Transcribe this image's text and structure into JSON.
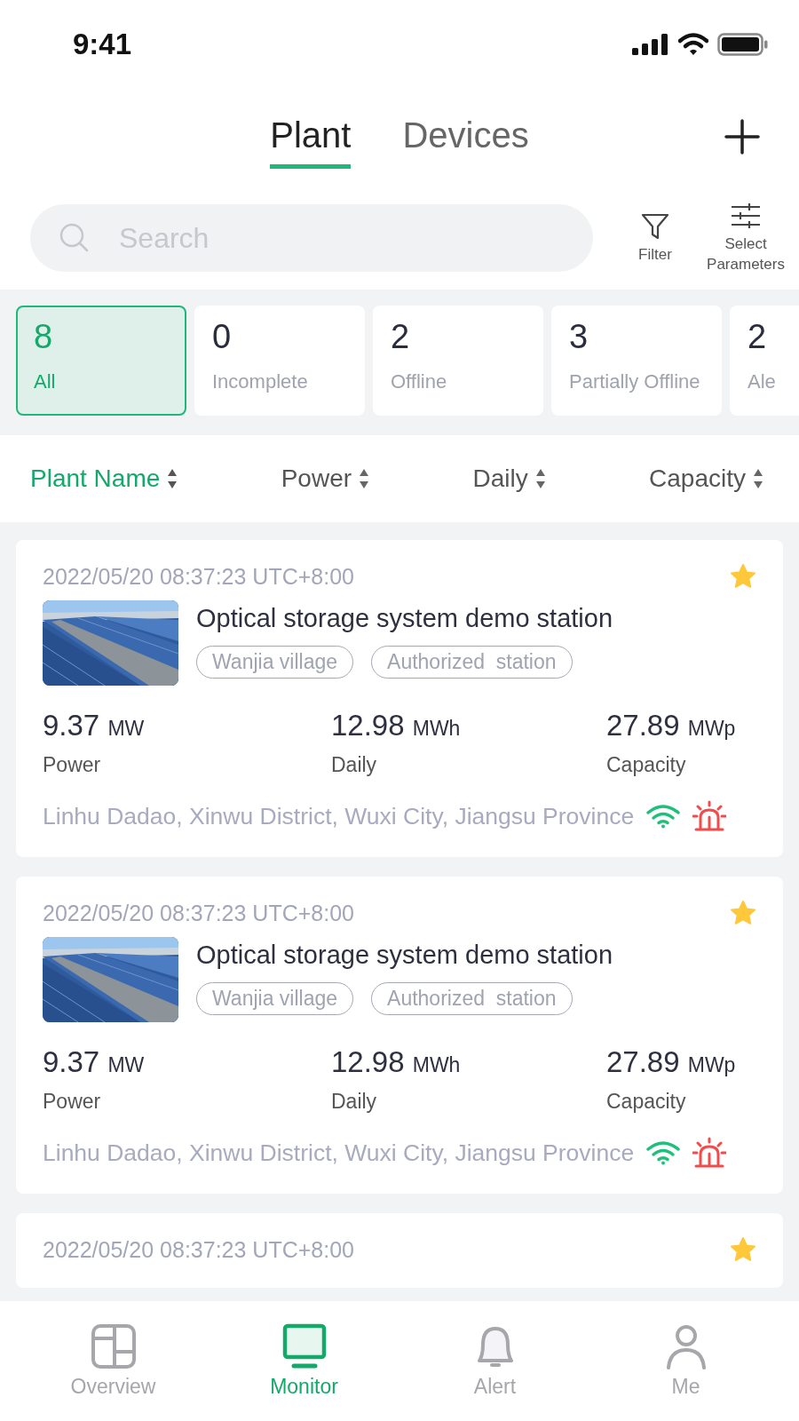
{
  "status_bar": {
    "time": "9:41"
  },
  "tabs": [
    {
      "label": "Plant",
      "selected": true
    },
    {
      "label": "Devices",
      "selected": false
    }
  ],
  "search": {
    "placeholder": "Search"
  },
  "tools": [
    {
      "kind": "filter",
      "label": "Filter"
    },
    {
      "kind": "parameters",
      "label": "Select Parameters"
    }
  ],
  "status_filters": [
    {
      "count": "8",
      "label": "All",
      "selected": true
    },
    {
      "count": "0",
      "label": "Incomplete",
      "selected": false
    },
    {
      "count": "2",
      "label": "Offline",
      "selected": false
    },
    {
      "count": "3",
      "label": "Partially Offline",
      "selected": false
    },
    {
      "count": "2",
      "label": "Ale",
      "selected": false
    }
  ],
  "sort_columns": [
    {
      "label": "Plant Name",
      "selected": true
    },
    {
      "label": "Power",
      "selected": false
    },
    {
      "label": "Daily",
      "selected": false
    },
    {
      "label": "Capacity",
      "selected": false
    }
  ],
  "plants": [
    {
      "timestamp": "2022/05/20 08:37:23 UTC+8:00",
      "favorite": true,
      "image": {
        "kind": "picture"
      },
      "name": "Optical storage system demo station",
      "tags": [
        "Wanjia village",
        "Authorized  station"
      ],
      "metrics": [
        {
          "value": "9.37",
          "unit": "MW",
          "label": "Power"
        },
        {
          "value": "12.98",
          "unit": "MWh",
          "label": "Daily"
        },
        {
          "value": "27.89",
          "unit": "MWp",
          "label": "Capacity"
        }
      ],
      "address": "Linhu Dadao, Xinwu District, Wuxi City, Jiangsu Province",
      "online": true,
      "alarm": true
    },
    {
      "timestamp": "2022/05/20 08:37:23 UTC+8:00",
      "favorite": true,
      "image": {
        "kind": "picture"
      },
      "name": "Optical storage system demo station",
      "tags": [
        "Wanjia village",
        "Authorized  station"
      ],
      "metrics": [
        {
          "value": "9.37",
          "unit": "MW",
          "label": "Power"
        },
        {
          "value": "12.98",
          "unit": "MWh",
          "label": "Daily"
        },
        {
          "value": "27.89",
          "unit": "MWp",
          "label": "Capacity"
        }
      ],
      "address": "Linhu Dadao, Xinwu District, Wuxi City, Jiangsu Province",
      "online": true,
      "alarm": true
    },
    {
      "timestamp": "2022/05/20 08:37:23 UTC+8:00",
      "favorite": true
    }
  ],
  "bottom_nav": [
    {
      "kind": "overview",
      "label": "Overview",
      "selected": false
    },
    {
      "kind": "monitor",
      "label": "Monitor",
      "selected": true
    },
    {
      "kind": "alert",
      "label": "Alert",
      "selected": false
    },
    {
      "kind": "me",
      "label": "Me",
      "selected": false
    }
  ]
}
